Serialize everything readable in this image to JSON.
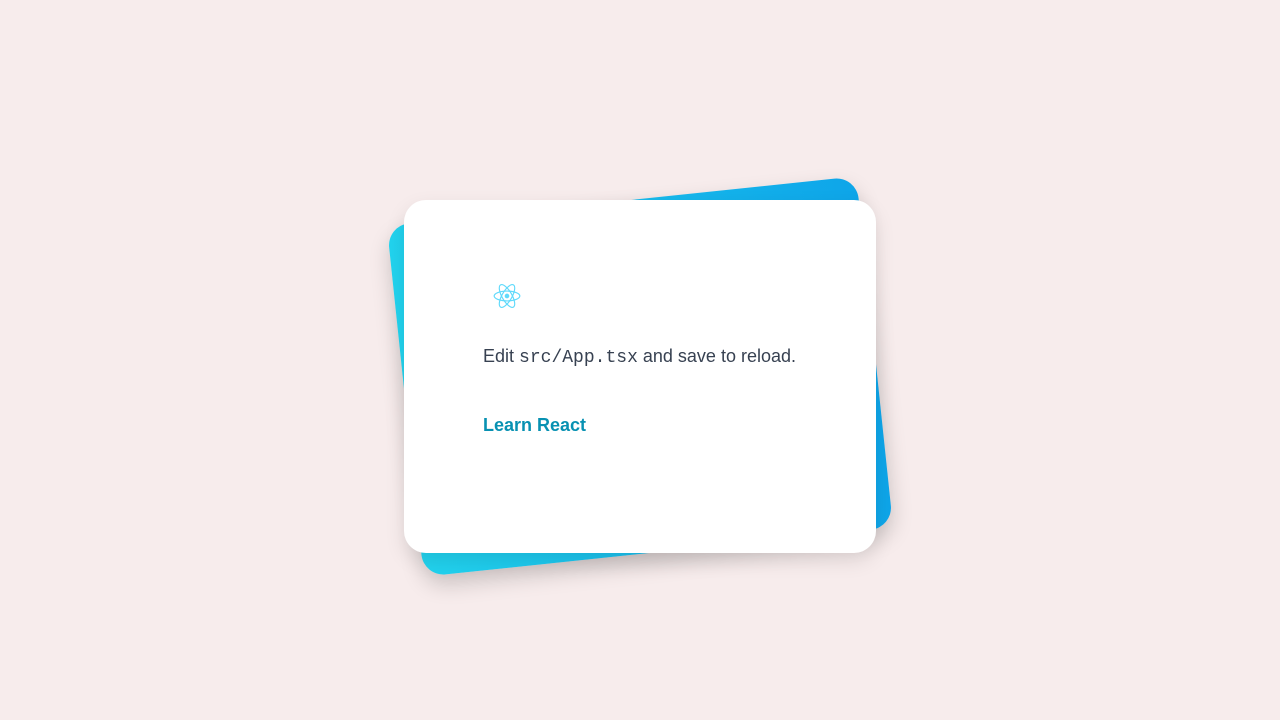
{
  "card": {
    "edit_prefix": "Edit",
    "file_path": "src/App.tsx",
    "edit_suffix": "and save to reload.",
    "link_label": "Learn React"
  },
  "icons": {
    "logo": "react-logo-icon"
  },
  "colors": {
    "background": "#f7ecec",
    "gradient_start": "#22d3ee",
    "gradient_end": "#0ea5e9",
    "link": "#0891b2",
    "text": "#374151",
    "logo": "#61dafb"
  }
}
